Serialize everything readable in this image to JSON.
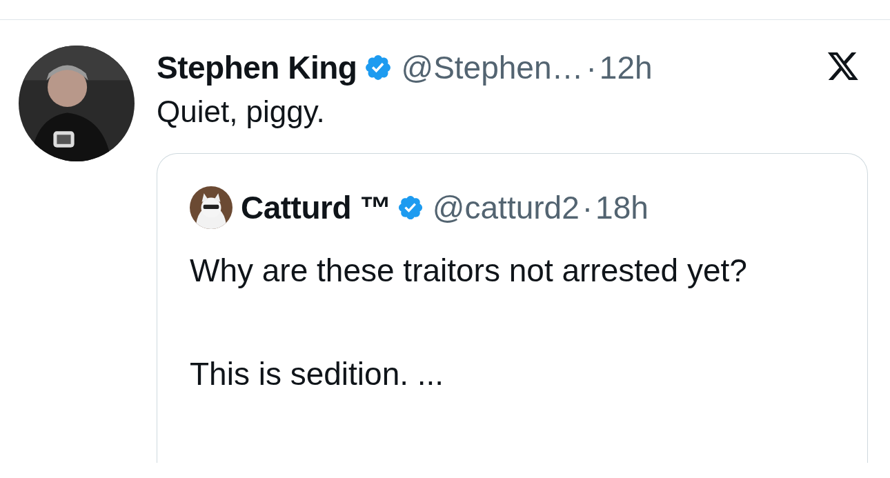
{
  "tweet": {
    "author": {
      "name": "Stephen King",
      "verified": true,
      "handle": "@Stephen…",
      "separator": "·",
      "time": "12h"
    },
    "text": "Quiet, piggy.",
    "quote": {
      "author": {
        "name": "Catturd ™",
        "verified": true,
        "handle": "@catturd2",
        "separator": "·",
        "time": "18h"
      },
      "paragraphs": [
        "Why are these traitors not arrested yet?",
        "This is sedition. ..."
      ]
    }
  }
}
